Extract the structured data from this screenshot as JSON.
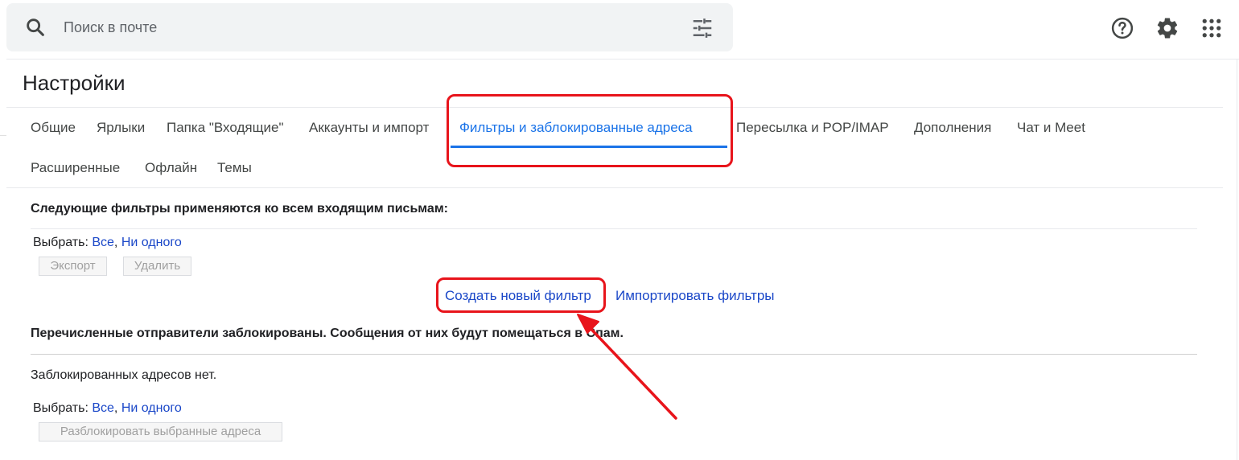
{
  "search": {
    "placeholder": "Поиск в почте"
  },
  "icons": {
    "search": "search-icon",
    "tune": "tune-icon",
    "help": "help-icon",
    "settings": "gear-icon",
    "apps": "apps-grid-icon"
  },
  "page": {
    "title": "Настройки"
  },
  "tabs": [
    {
      "label": "Общие",
      "active": false
    },
    {
      "label": "Ярлыки",
      "active": false
    },
    {
      "label": "Папка \"Входящие\"",
      "active": false
    },
    {
      "label": "Аккаунты и импорт",
      "active": false
    },
    {
      "label": "Фильтры и заблокированные адреса",
      "active": true
    },
    {
      "label": "Пересылка и POP/IMAP",
      "active": false
    },
    {
      "label": "Дополнения",
      "active": false
    },
    {
      "label": "Чат и Meet",
      "active": false
    },
    {
      "label": "Расширенные",
      "active": false
    },
    {
      "label": "Офлайн",
      "active": false
    },
    {
      "label": "Темы",
      "active": false
    }
  ],
  "filters": {
    "heading": "Следующие фильтры применяются ко всем входящим письмам:",
    "select_label": "Выбрать:",
    "select_all": "Все",
    "select_none": "Ни одного",
    "export_button": "Экспорт",
    "delete_button": "Удалить",
    "create_link": "Создать новый фильтр",
    "import_link": "Импортировать фильтры"
  },
  "blocked": {
    "heading": "Перечисленные отправители заблокированы. Сообщения от них будут помещаться в Спам.",
    "empty_text": "Заблокированных адресов нет.",
    "select_label": "Выбрать:",
    "select_all": "Все",
    "select_none": "Ни одного",
    "unblock_button": "Разблокировать выбранные адреса"
  },
  "colors": {
    "accent": "#1a73e8",
    "link": "#1a47c8",
    "highlight": "#e8141b"
  }
}
